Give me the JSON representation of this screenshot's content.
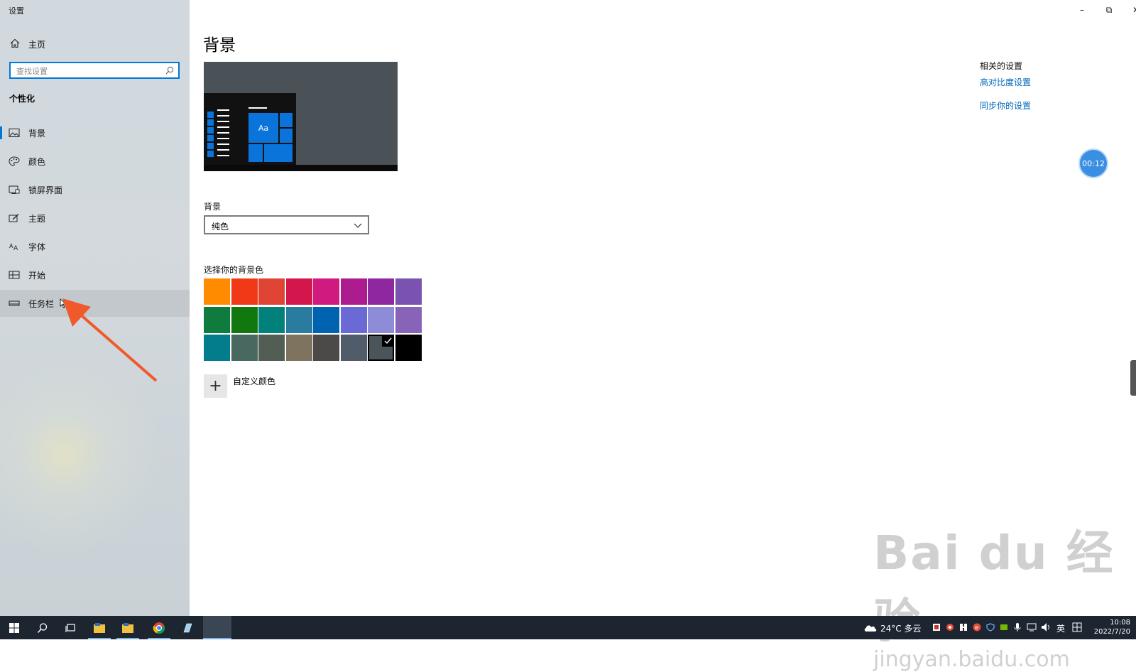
{
  "window": {
    "title": "设置",
    "controls": {
      "minimize": "–",
      "restore": "⧉",
      "close": "✕"
    }
  },
  "sidebar": {
    "home_label": "主页",
    "search_placeholder": "查找设置",
    "section_title": "个性化",
    "items": [
      {
        "label": "背景",
        "icon": "picture-icon",
        "active": true
      },
      {
        "label": "颜色",
        "icon": "palette-icon"
      },
      {
        "label": "锁屏界面",
        "icon": "lock-screen-icon"
      },
      {
        "label": "主题",
        "icon": "theme-brush-icon"
      },
      {
        "label": "字体",
        "icon": "font-icon"
      },
      {
        "label": "开始",
        "icon": "start-icon"
      },
      {
        "label": "任务栏",
        "icon": "taskbar-icon",
        "hover": true
      }
    ]
  },
  "main": {
    "title": "背景",
    "background_label": "背景",
    "background_value": "纯色",
    "color_section_label": "选择你的背景色",
    "colors": [
      [
        "#FF8C00",
        "#F03A17",
        "#E04434",
        "#D3174D",
        "#D11A80",
        "#AD1C8E",
        "#8E27A0",
        "#7A52B0"
      ],
      [
        "#0F7B3F",
        "#117810",
        "#00827A",
        "#2A7BA0",
        "#0063B1",
        "#6B69D6",
        "#8E8CD8",
        "#8764B8"
      ],
      [
        "#037C8C",
        "#486860",
        "#525E54",
        "#7E735F",
        "#4C4A48",
        "#515C6B",
        "#4A5459",
        "#000000"
      ]
    ],
    "selected_color": "#4A5459",
    "custom_color_label": "自定义颜色"
  },
  "related": {
    "title": "相关的设置",
    "links": [
      "高对比度设置",
      "同步你的设置"
    ]
  },
  "overlay": {
    "timer": "00:12",
    "arrow_color": "#F05A2B"
  },
  "watermark": {
    "line1": "Bai du 经验",
    "line2": "jingyan.baidu.com"
  },
  "taskbar": {
    "weather": "24°C 多云",
    "ime": "英",
    "time": "10:08",
    "date": "2022/7/20"
  }
}
